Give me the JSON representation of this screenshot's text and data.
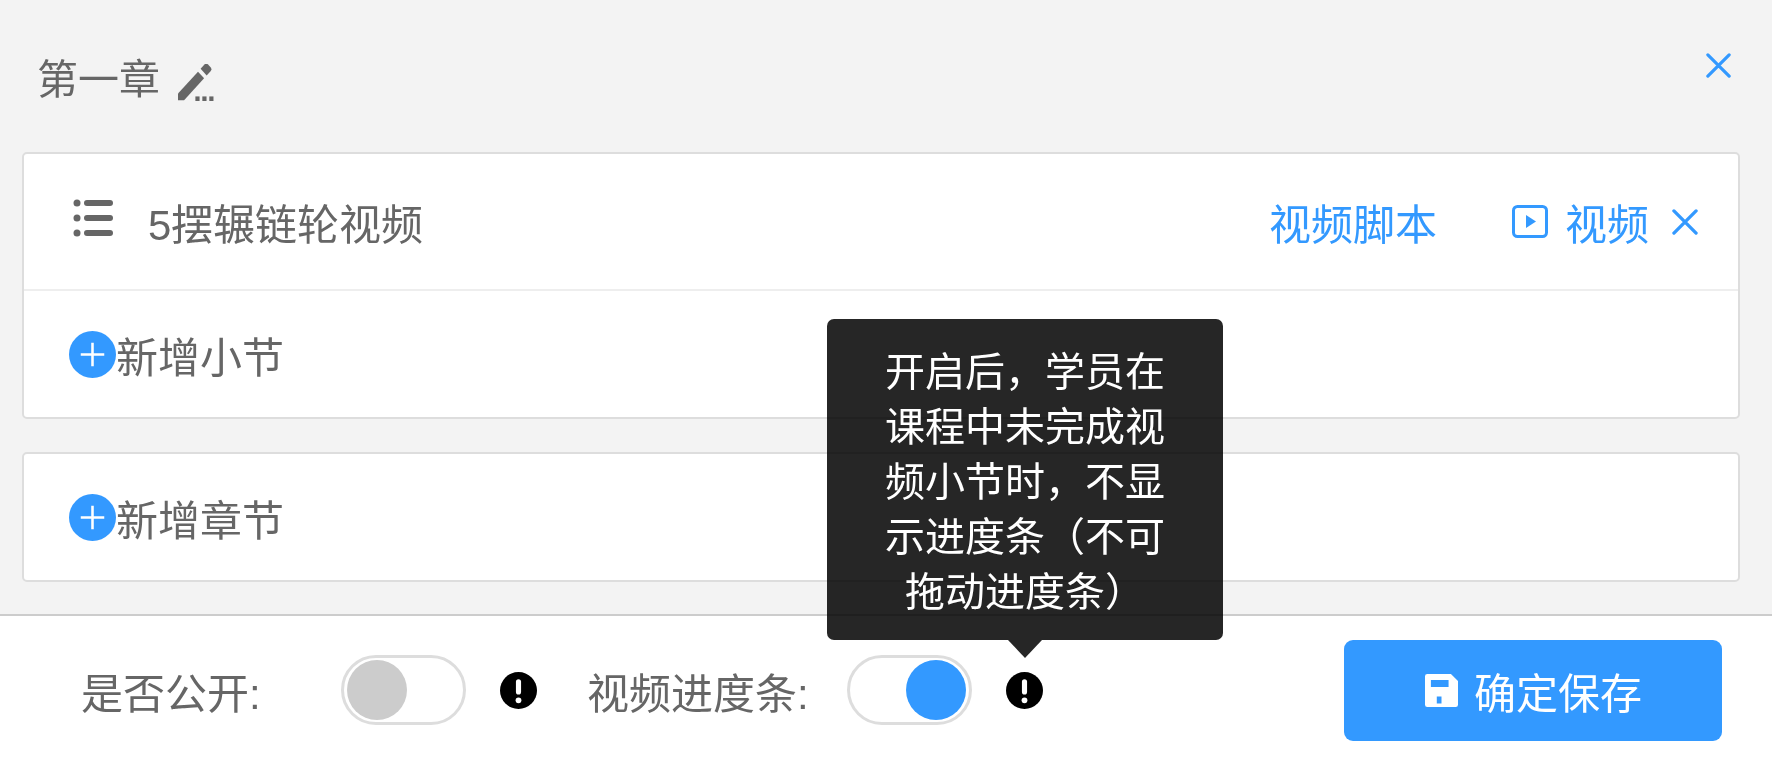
{
  "chapter": {
    "title": "第一章",
    "sections": [
      {
        "title": "5摆辗链轮视频",
        "script_link": "视频脚本",
        "media": {
          "kind": "video",
          "label": "视频"
        }
      }
    ],
    "add_section": "新增小节"
  },
  "add_chapter": "新增章节",
  "settings": [
    {
      "label": "是否公开:",
      "on": false
    },
    {
      "label": "视频进度条:",
      "on": true,
      "tooltip": "开启后，学员在课程中未完成视频小节时，不显示进度条（不可拖动进度条）"
    }
  ],
  "save_button": "确定保存"
}
